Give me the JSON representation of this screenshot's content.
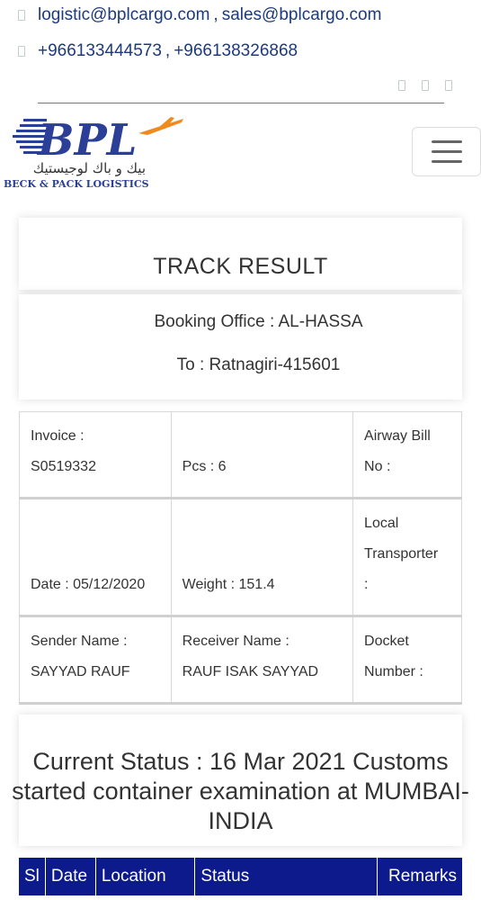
{
  "contacts": {
    "email1": "logistic@bplcargo.com",
    "email2": "sales@bplcargo.com",
    "email_sep": ",",
    "phone1": "+966133444573",
    "phone2": "+966138326868",
    "phone_sep": ","
  },
  "logo": {
    "text": "BPL",
    "arabic": "بيك و باك لوجيستيك",
    "tagline": "BECK & PACK LOGISTICS"
  },
  "track": {
    "title": "TRACK RESULT",
    "booking_office": "Booking Office : AL-HASSA",
    "to": "To : Ratnagiri-415601"
  },
  "details": {
    "invoice_label": "Invoice :",
    "invoice_value": "S0519332",
    "pcs": "Pcs : 6",
    "airway_bill_label": "Airway Bill",
    "airway_bill_no": "No :",
    "date": "Date : 05/12/2020",
    "weight": "Weight : 151.4",
    "local_label": "Local",
    "transporter_label": "Transporter",
    "transporter_colon": ":",
    "sender_label": "Sender Name :",
    "sender_value": "SAYYAD RAUF",
    "receiver_label": "Receiver Name :",
    "receiver_value": "RAUF ISAK SAYYAD",
    "docket_label": "Docket",
    "docket_number": "Number :"
  },
  "current_status": "Current Status : 16 Mar 2021 Customs started container examination at MUMBAI-INDIA",
  "table_headers": [
    "Sl",
    "Date",
    "Location",
    "Status",
    "Remarks"
  ],
  "colors": {
    "accent": "#1d3a7a",
    "table_header_bg": "#0d1a8c",
    "logo_orange": "#f08a1e"
  }
}
